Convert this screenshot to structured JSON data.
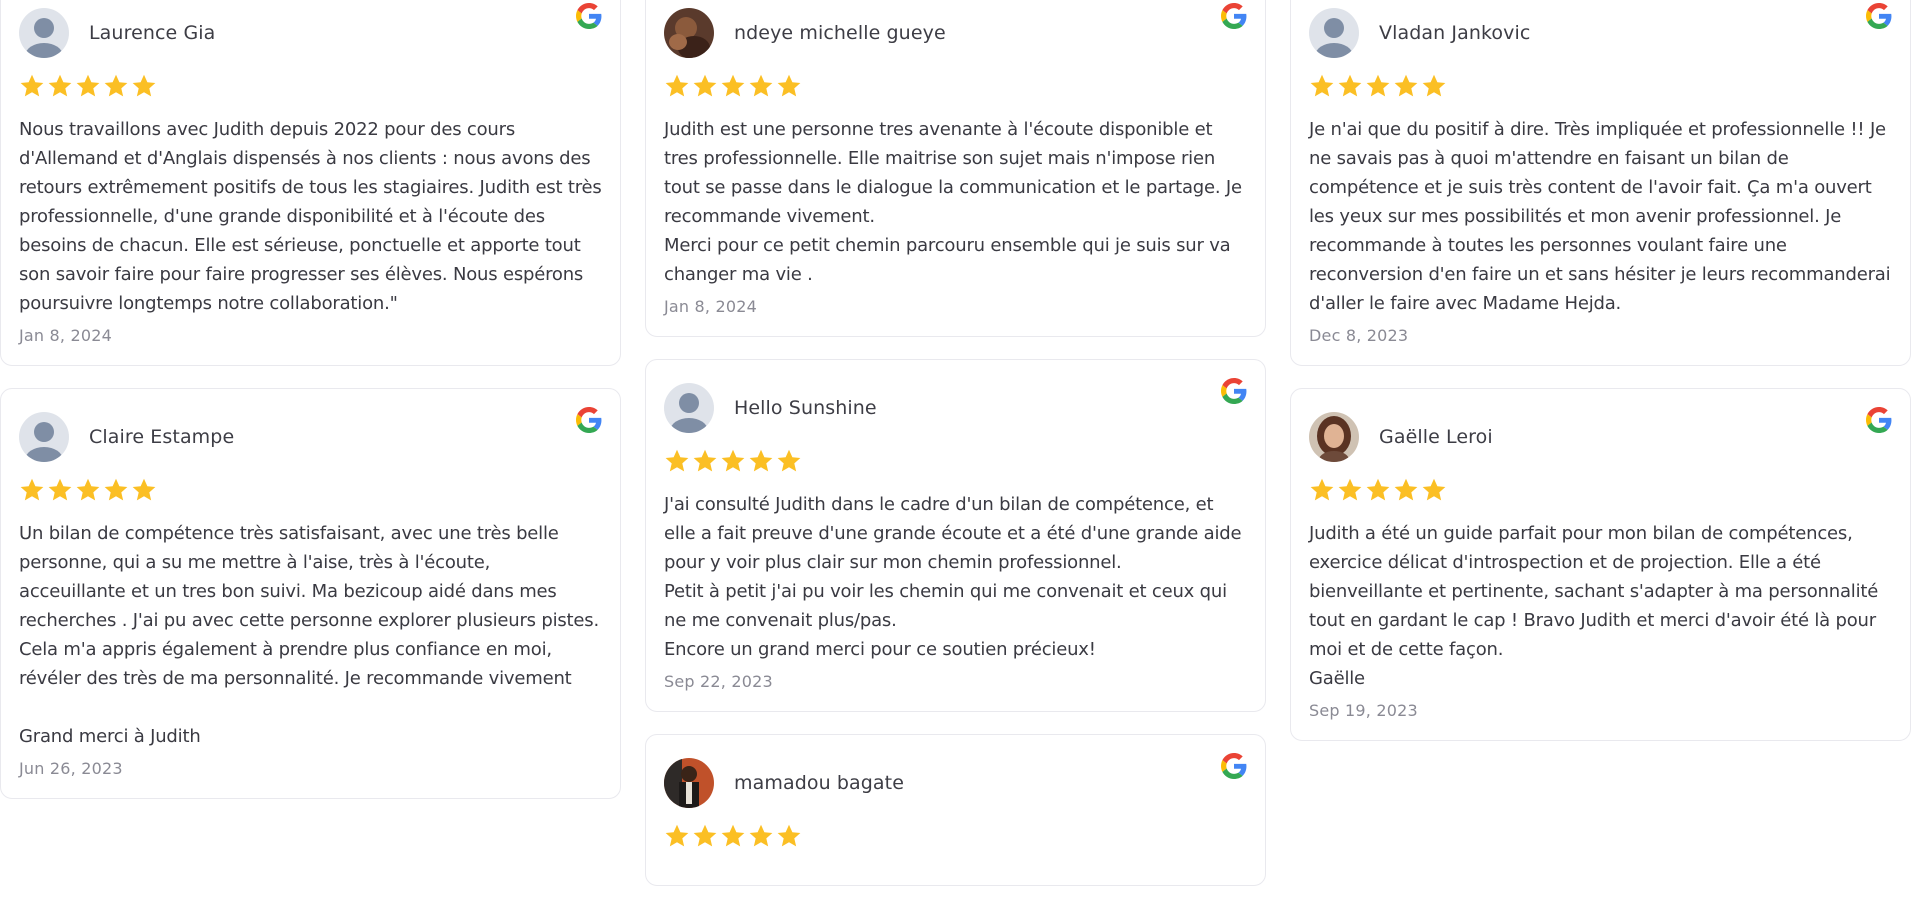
{
  "icons": {
    "google": "google-g-icon",
    "star": "star-icon",
    "avatar_placeholder": "user-avatar-placeholder"
  },
  "colors": {
    "star": "#fbbf24",
    "card_border": "#e9e9ee",
    "text": "#3a3a42",
    "date": "#8a8a94"
  },
  "reviews": [
    {
      "author": "Laurence Gia",
      "avatar": "placeholder",
      "rating": 5,
      "text": "Nous travaillons avec Judith depuis 2022 pour des cours d'Allemand et d'Anglais dispensés à nos clients : nous avons des retours extrêmement positifs de tous les stagiaires. Judith est très professionnelle, d'une grande disponibilité et à l'écoute des besoins de chacun. Elle est sérieuse, ponctuelle et apporte tout son savoir faire pour faire progresser ses élèves. Nous espérons poursuivre longtemps notre collaboration.\"",
      "date": "Jan 8, 2024"
    },
    {
      "author": "Claire Estampe",
      "avatar": "placeholder",
      "rating": 5,
      "text": "Un bilan de compétence très satisfaisant, avec une très belle personne, qui a su me mettre à l'aise, très à l'écoute, acceuillante et un tres bon suivi. Ma bezicoup aidé dans mes recherches . J'ai pu avec cette personne explorer plusieurs pistes. Cela m'a appris également à prendre plus confiance en moi, révéler des très de ma personnalité. Je recommande vivement\n\nGrand merci à Judith",
      "date": "Jun 26, 2023"
    },
    {
      "author": "ndeye michelle gueye",
      "avatar": "photo",
      "rating": 5,
      "text": "Judith est une personne tres avenante à l'écoute disponible et tres professionnelle. Elle maitrise son sujet mais n'impose rien tout se passe dans le dialogue la communication et le partage. Je recommande vivement.\nMerci pour ce petit chemin parcouru ensemble qui je suis sur va changer ma vie .",
      "date": "Jan 8, 2024"
    },
    {
      "author": "Hello Sunshine",
      "avatar": "placeholder",
      "rating": 5,
      "text": "J'ai consulté Judith dans le cadre d'un bilan de compétence, et elle a fait preuve d'une grande écoute et a été d'une grande aide pour y voir plus clair sur mon chemin professionnel.\nPetit à petit j'ai pu voir les chemin qui me convenait et ceux qui ne me convenait plus/pas.\nEncore un grand merci pour ce soutien précieux!",
      "date": "Sep 22, 2023"
    },
    {
      "author": "mamadou bagate",
      "avatar": "photo",
      "rating": 5,
      "text": "",
      "date": ""
    },
    {
      "author": "Vladan Jankovic",
      "avatar": "placeholder",
      "rating": 5,
      "text": "Je n'ai que du positif à dire. Très impliquée et professionnelle !! Je ne savais pas à quoi m'attendre en faisant un bilan de compétence et je suis très content de l'avoir fait. Ça m'a ouvert les yeux sur mes possibilités et mon avenir professionnel. Je recommande à toutes les personnes voulant faire une reconversion d'en faire un et sans hésiter je leurs recommanderai d'aller le faire avec Madame Hejda.",
      "date": "Dec 8, 2023"
    },
    {
      "author": "Gaëlle Leroi",
      "avatar": "photo",
      "rating": 5,
      "text": "Judith a été un guide parfait pour mon bilan de compétences, exercice délicat d'introspection et de projection. Elle a été bienveillante et pertinente, sachant s'adapter à ma personnalité tout en gardant le cap ! Bravo Judith et merci d'avoir été là pour moi et de cette façon.\nGaëlle",
      "date": "Sep 19, 2023"
    }
  ]
}
